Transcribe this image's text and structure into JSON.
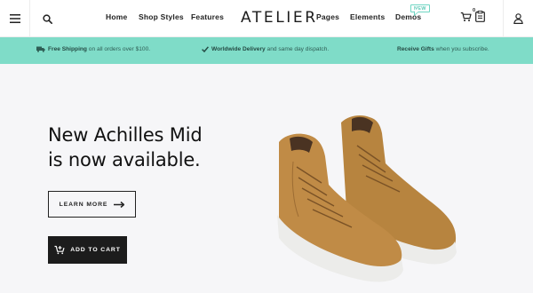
{
  "header": {
    "logo": "ATELIER",
    "nav": [
      {
        "label": "Home"
      },
      {
        "label": "Shop Styles"
      },
      {
        "label": "Features"
      },
      {
        "label": "Pages"
      },
      {
        "label": "Elements"
      },
      {
        "label": "Demos"
      }
    ],
    "demos_badge": "NEW",
    "cart_count": "0",
    "icons": {
      "menu": "hamburger-icon",
      "search": "search-icon",
      "cart": "cart-icon",
      "wishlist": "clipboard-icon",
      "account": "user-icon"
    }
  },
  "promo": {
    "shipping": {
      "strong": "Free Shipping",
      "text": " on all orders over $100.",
      "icon": "truck-icon"
    },
    "delivery": {
      "strong": "Worldwide Delivery",
      "text": " and same day dispatch.",
      "icon": "check-icon"
    },
    "gifts": {
      "strong": "Receive Gifts",
      "text": " when you subscribe."
    }
  },
  "hero": {
    "headline_line1": "New Achilles Mid",
    "headline_line2": "is now available.",
    "learn_more": "LEARN MORE",
    "add_to_cart": "ADD TO CART",
    "image": "tan-suede-sneakers"
  },
  "colors": {
    "promo_bg": "#7fdcc8",
    "hero_bg": "#f6f6f8",
    "button_dark": "#1c1c1c",
    "accent": "#6fd6c3"
  }
}
